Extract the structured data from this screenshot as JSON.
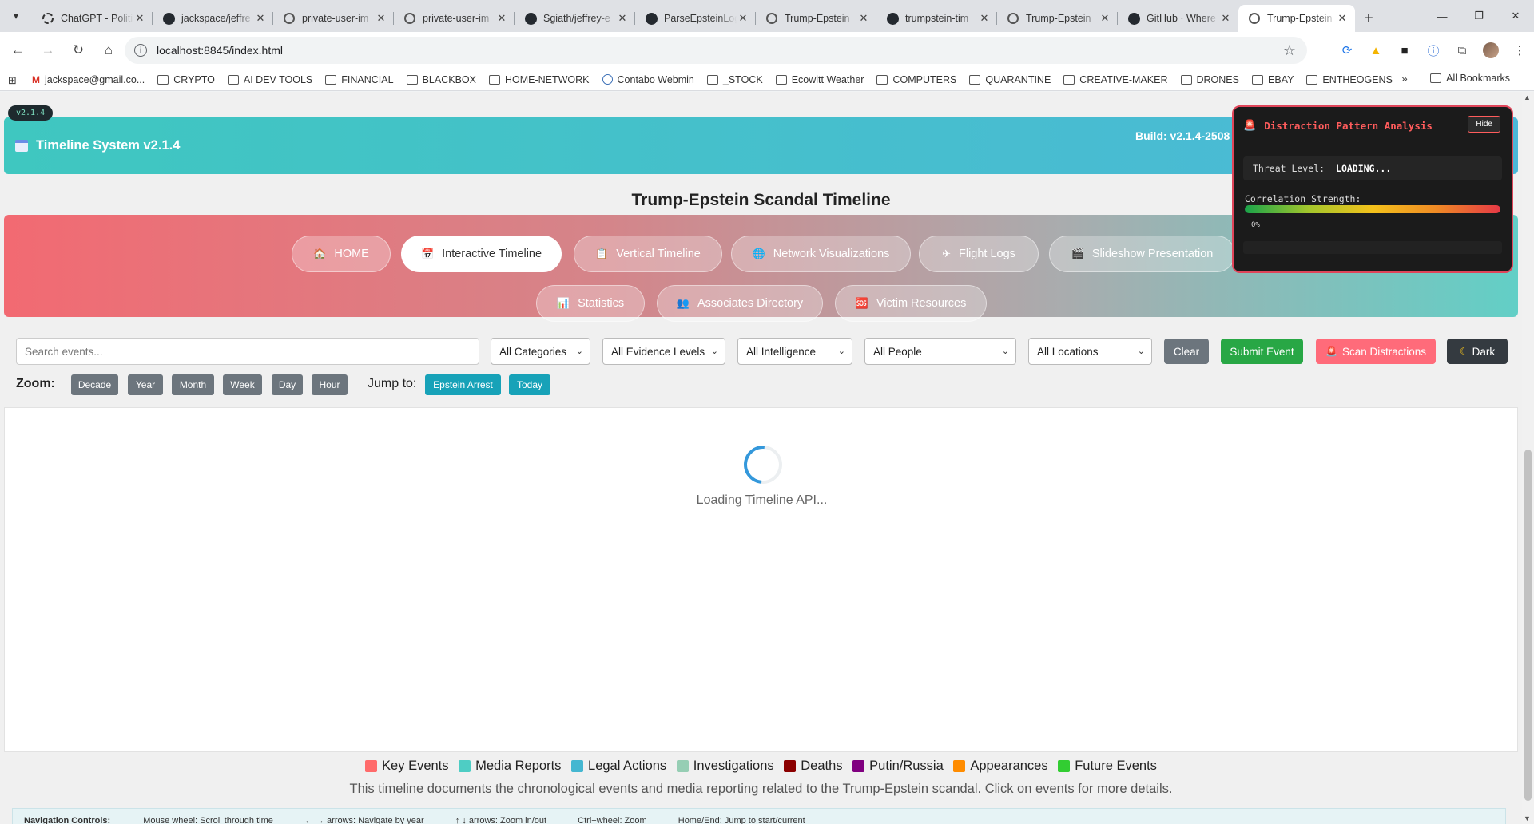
{
  "browser": {
    "tabs": [
      {
        "title": "ChatGPT - Politi",
        "icon": "gpt"
      },
      {
        "title": "jackspace/jeffre",
        "icon": "github"
      },
      {
        "title": "private-user-im",
        "icon": "globe"
      },
      {
        "title": "private-user-im",
        "icon": "globe"
      },
      {
        "title": "Sgiath/jeffrey-e",
        "icon": "github"
      },
      {
        "title": "ParseEpsteinLog",
        "icon": "github"
      },
      {
        "title": "Trump-Epstein",
        "icon": "globe"
      },
      {
        "title": "trumpstein-tim",
        "icon": "github"
      },
      {
        "title": "Trump-Epstein",
        "icon": "globe"
      },
      {
        "title": "GitHub · Where",
        "icon": "github"
      },
      {
        "title": "Trump-Epstein",
        "icon": "globe",
        "active": true
      }
    ],
    "url": "localhost:8845/index.html",
    "bookmarks": [
      {
        "label": "jackspace@gmail.co...",
        "icon": "mail"
      },
      {
        "label": "CRYPTO",
        "icon": "folder"
      },
      {
        "label": "AI DEV TOOLS",
        "icon": "folder"
      },
      {
        "label": "FINANCIAL",
        "icon": "folder"
      },
      {
        "label": "BLACKBOX",
        "icon": "folder"
      },
      {
        "label": "HOME-NETWORK",
        "icon": "folder"
      },
      {
        "label": "Contabo Webmin",
        "icon": "site"
      },
      {
        "label": "_STOCK",
        "icon": "folder"
      },
      {
        "label": "Ecowitt Weather",
        "icon": "site"
      },
      {
        "label": "COMPUTERS",
        "icon": "folder"
      },
      {
        "label": "QUARANTINE",
        "icon": "folder"
      },
      {
        "label": "CREATIVE-MAKER",
        "icon": "folder"
      },
      {
        "label": "DRONES",
        "icon": "folder"
      },
      {
        "label": "EBAY",
        "icon": "folder"
      },
      {
        "label": "ENTHEOGENS",
        "icon": "folder"
      }
    ],
    "all_bookmarks": "All Bookmarks"
  },
  "app": {
    "version_badge": "v2.1.4",
    "header_title": "Timeline System v2.1.4",
    "build": "Build: v2.1.4-2508",
    "page_title": "Trump-Epstein Scandal Timeline",
    "nav": [
      {
        "label": "HOME",
        "icon": "🏠"
      },
      {
        "label": "Interactive Timeline",
        "icon": "📅",
        "active": true
      },
      {
        "label": "Vertical Timeline",
        "icon": "📋"
      },
      {
        "label": "Network Visualizations",
        "icon": "🌐"
      },
      {
        "label": "Flight Logs",
        "icon": "✈"
      },
      {
        "label": "Slideshow Presentation",
        "icon": "🎬"
      },
      {
        "label": "Statistics",
        "icon": "📊"
      },
      {
        "label": "Associates Directory",
        "icon": "👥"
      },
      {
        "label": "Victim Resources",
        "icon": "🆘"
      }
    ],
    "search_placeholder": "Search events...",
    "filters": {
      "categories": "All Categories",
      "evidence": "All Evidence Levels",
      "intelligence": "All Intelligence",
      "people": "All People",
      "locations": "All Locations"
    },
    "buttons": {
      "clear": "Clear",
      "submit": "Submit Event",
      "scan": "Scan Distractions",
      "dark": "Dark"
    },
    "zoom_label": "Zoom:",
    "zoom_levels": [
      "Decade",
      "Year",
      "Month",
      "Week",
      "Day",
      "Hour"
    ],
    "jump_label": "Jump to:",
    "jump_targets": [
      "Epstein Arrest",
      "Today"
    ],
    "loading_text": "Loading Timeline API...",
    "legend": [
      {
        "label": "Key Events",
        "color": "#ff6b6b"
      },
      {
        "label": "Media Reports",
        "color": "#4ecdc4"
      },
      {
        "label": "Legal Actions",
        "color": "#45b7d1"
      },
      {
        "label": "Investigations",
        "color": "#96ceb4"
      },
      {
        "label": "Deaths",
        "color": "#8b0000"
      },
      {
        "label": "Putin/Russia",
        "color": "#800080"
      },
      {
        "label": "Appearances",
        "color": "#ff8c00"
      },
      {
        "label": "Future Events",
        "color": "#32cd32"
      }
    ],
    "description": "This timeline documents the chronological events and media reporting related to the Trump-Epstein scandal. Click on events for more details.",
    "navigation_controls": {
      "title": "Navigation Controls:",
      "items": [
        "Mouse wheel: Scroll through time",
        "← → arrows: Navigate by year",
        "↑ ↓ arrows: Zoom in/out",
        "Ctrl+wheel: Zoom",
        "Home/End: Jump to start/current"
      ]
    }
  },
  "distraction_panel": {
    "title": "Distraction Pattern Analysis",
    "hide": "Hide",
    "threat_label": "Threat Level:",
    "threat_value": "LOADING...",
    "correlation_label": "Correlation Strength:",
    "correlation_value": "0%",
    "correlation_fraction": 0
  }
}
